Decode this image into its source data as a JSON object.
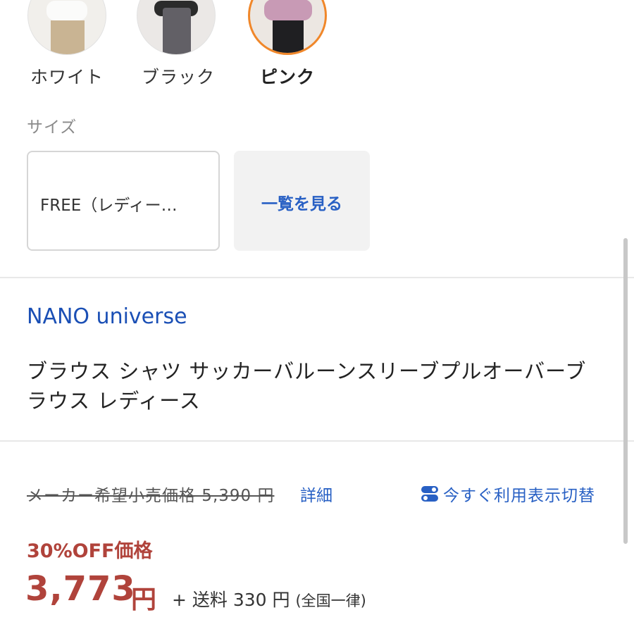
{
  "colors": {
    "accent_blue": "#2860c4",
    "price_red": "#b0433b",
    "selected_ring": "#f0872a"
  },
  "swatches": [
    {
      "label": "ホワイト",
      "selected": false
    },
    {
      "label": "ブラック",
      "selected": false
    },
    {
      "label": "ピンク",
      "selected": true
    }
  ],
  "size": {
    "section_label": "サイズ",
    "selected_value": "FREE（レディー…",
    "list_button_label": "一覧を見る"
  },
  "product": {
    "brand": "NANO universe",
    "title": "ブラウス シャツ サッカーバルーンスリーブプルオーバーブラウス レディース"
  },
  "pricing": {
    "list_price": "メーカー希望小売価格 5,390 円",
    "details_link": "詳細",
    "toggle_label": "今すぐ利用表示切替",
    "toggle_icon": "toggle-switch-icon",
    "discount_label": "30%OFF価格",
    "price": "3,773",
    "price_unit": "円",
    "shipping": "+ 送料 330 円",
    "shipping_note": "(全国一律)"
  }
}
